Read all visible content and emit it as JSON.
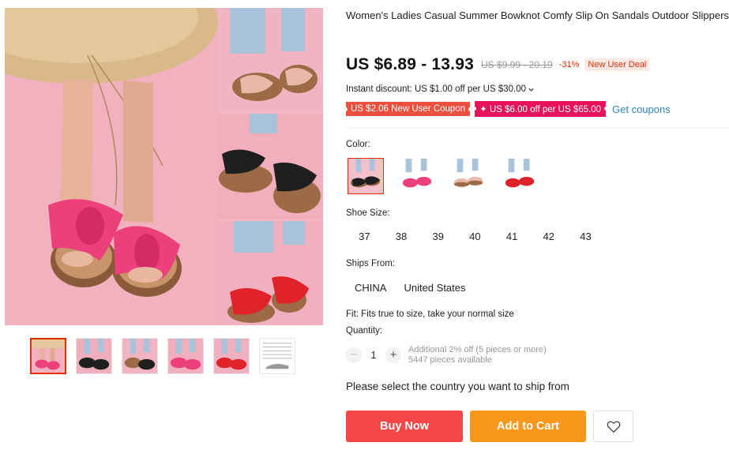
{
  "product": {
    "title": "Women's Ladies Casual Summer Bowknot Comfy Slip On Sandals Outdoor Slippers Женские Босоножки"
  },
  "price": {
    "current": "US $6.89 - 13.93",
    "original": "US $9.99 - 20.19",
    "discount": "-31%",
    "deal_badge": "New User Deal"
  },
  "instant_discount": {
    "text": "Instant discount: US $1.00 off per US $30.00",
    "icon": "chevron-down-icon"
  },
  "coupons": {
    "items": [
      "US $2.06 New User Coupon",
      "✦ US $6.00 off per US $65.00"
    ],
    "get_label": "Get coupons"
  },
  "color": {
    "label": "Color:",
    "options": [
      "black",
      "pink",
      "khaki",
      "red"
    ],
    "selected": 0
  },
  "size": {
    "label": "Shoe Size:",
    "options": [
      "37",
      "38",
      "39",
      "40",
      "41",
      "42",
      "43"
    ]
  },
  "ships_from": {
    "label": "Ships From:",
    "options": [
      "CHINA",
      "United States"
    ]
  },
  "fit": "Fit: Fits true to size, take your normal size",
  "quantity": {
    "label": "Quantity:",
    "value": "1",
    "minus": "−",
    "plus": "+",
    "note_line1": "Additional 2% off (5 pieces or more)",
    "note_line2": "5447 pieces available"
  },
  "ship_message": "Please select the country you want to ship from",
  "actions": {
    "buy_now": "Buy Now",
    "add_to_cart": "Add to Cart",
    "wishlist_icon": "heart-icon"
  },
  "colors": {
    "accent": "#e62e04",
    "buy_now": "#f44848",
    "add_to_cart": "#f7971c",
    "link": "#2e84c5",
    "coupon_red": "#f14f3e",
    "coupon_pink": "#e8125c",
    "background_pink": "#f4b7c3"
  }
}
